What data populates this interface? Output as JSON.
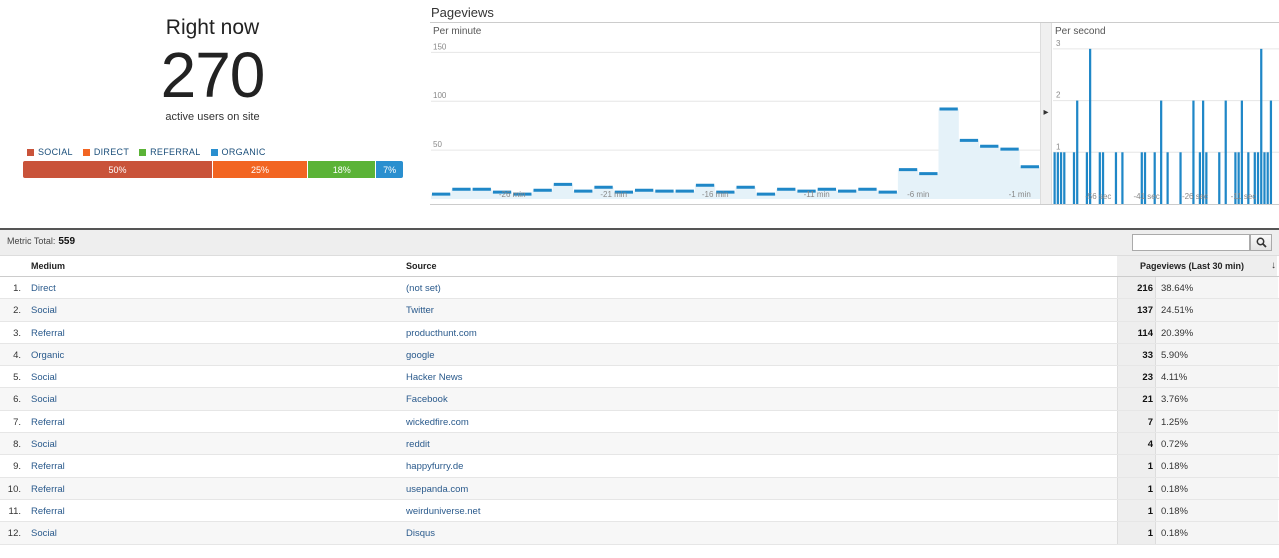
{
  "right_now": {
    "title": "Right now",
    "count": "270",
    "subtitle": "active users on site",
    "legend": [
      {
        "label": "SOCIAL",
        "color": "#c9533a"
      },
      {
        "label": "DIRECT",
        "color": "#f26522"
      },
      {
        "label": "REFERRAL",
        "color": "#5bb337"
      },
      {
        "label": "ORGANIC",
        "color": "#2a8fcf"
      }
    ],
    "breakdown": [
      {
        "label": "50%",
        "percent": 50,
        "color": "#c9533a"
      },
      {
        "label": "25%",
        "percent": 25,
        "color": "#f26522"
      },
      {
        "label": "18%",
        "percent": 18,
        "color": "#5bb337"
      },
      {
        "label": "7%",
        "percent": 7,
        "color": "#2a8fcf"
      }
    ]
  },
  "pageviews": {
    "title": "Pageviews",
    "per_minute_label": "Per minute",
    "per_second_label": "Per second"
  },
  "chart_data": [
    {
      "type": "area",
      "title": "Per minute",
      "ylim": [
        0,
        180
      ],
      "yticks": [
        50,
        100,
        150
      ],
      "xtick_labels": [
        "-26 min",
        "-21 min",
        "-16 min",
        "-11 min",
        "-6 min",
        "-1 min"
      ],
      "x_ticks_min": [
        -26,
        -21,
        -16,
        -11,
        -6,
        -1
      ],
      "x": [
        -30,
        -29,
        -28,
        -27,
        -26,
        -25,
        -24,
        -23,
        -22,
        -21,
        -20,
        -19,
        -18,
        -17,
        -16,
        -15,
        -14,
        -13,
        -12,
        -11,
        -10,
        -9,
        -8,
        -7,
        -6,
        -5,
        -4,
        -3,
        -2,
        -1
      ],
      "values": [
        5,
        10,
        10,
        7,
        5,
        9,
        15,
        8,
        12,
        7,
        9,
        8,
        8,
        14,
        7,
        12,
        5,
        10,
        8,
        10,
        8,
        10,
        7,
        30,
        26,
        92,
        60,
        54,
        51,
        33
      ]
    },
    {
      "type": "bar",
      "title": "Per second",
      "ylim": [
        0,
        3.5
      ],
      "yticks": [
        1,
        2,
        3
      ],
      "xtick_labels": [
        "-56 sec",
        "-41 sec",
        "-26 sec",
        "-11 sec"
      ],
      "x_ticks_sec": [
        -56,
        -41,
        -26,
        -11
      ],
      "values": [
        1,
        1,
        1,
        1,
        0,
        0,
        1,
        2,
        0,
        0,
        1,
        3,
        0,
        0,
        1,
        1,
        0,
        0,
        0,
        1,
        0,
        1,
        0,
        0,
        0,
        0,
        0,
        1,
        1,
        0,
        0,
        1,
        0,
        2,
        0,
        1,
        0,
        0,
        0,
        1,
        0,
        0,
        0,
        2,
        0,
        1,
        2,
        1,
        0,
        0,
        0,
        1,
        0,
        2,
        0,
        0,
        1,
        1,
        2,
        0,
        1,
        0,
        1,
        1,
        3,
        1,
        1,
        2,
        0,
        0
      ]
    }
  ],
  "table": {
    "metric_total_label": "Metric Total:",
    "metric_total_value": "559",
    "search_placeholder": "",
    "headers": {
      "medium": "Medium",
      "source": "Source",
      "pageviews": "Pageviews (Last 30 min)"
    },
    "rows": [
      {
        "idx": "1.",
        "medium": "Direct",
        "source": "(not set)",
        "value": "216",
        "pct": "38.64%"
      },
      {
        "idx": "2.",
        "medium": "Social",
        "source": "Twitter",
        "value": "137",
        "pct": "24.51%"
      },
      {
        "idx": "3.",
        "medium": "Referral",
        "source": "producthunt.com",
        "value": "114",
        "pct": "20.39%"
      },
      {
        "idx": "4.",
        "medium": "Organic",
        "source": "google",
        "value": "33",
        "pct": "5.90%"
      },
      {
        "idx": "5.",
        "medium": "Social",
        "source": "Hacker News",
        "value": "23",
        "pct": "4.11%"
      },
      {
        "idx": "6.",
        "medium": "Social",
        "source": "Facebook",
        "value": "21",
        "pct": "3.76%"
      },
      {
        "idx": "7.",
        "medium": "Referral",
        "source": "wickedfire.com",
        "value": "7",
        "pct": "1.25%"
      },
      {
        "idx": "8.",
        "medium": "Social",
        "source": "reddit",
        "value": "4",
        "pct": "0.72%"
      },
      {
        "idx": "9.",
        "medium": "Referral",
        "source": "happyfurry.de",
        "value": "1",
        "pct": "0.18%"
      },
      {
        "idx": "10.",
        "medium": "Referral",
        "source": "usepanda.com",
        "value": "1",
        "pct": "0.18%"
      },
      {
        "idx": "11.",
        "medium": "Referral",
        "source": "weirduniverse.net",
        "value": "1",
        "pct": "0.18%"
      },
      {
        "idx": "12.",
        "medium": "Social",
        "source": "Disqus",
        "value": "1",
        "pct": "0.18%"
      }
    ]
  }
}
